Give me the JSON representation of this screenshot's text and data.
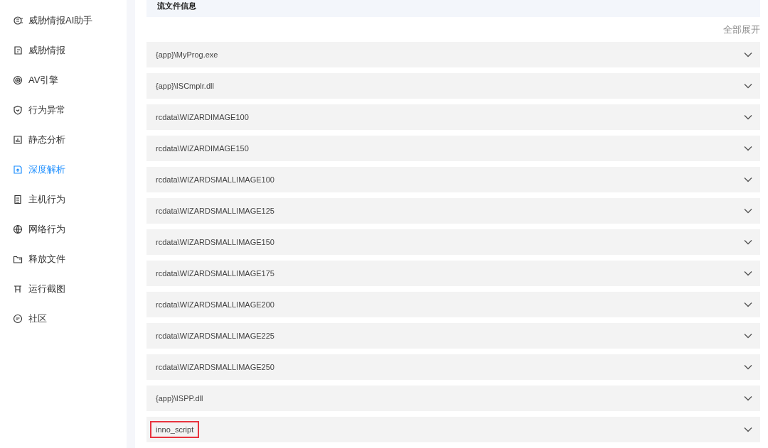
{
  "sidebar": {
    "items": [
      {
        "label": "威胁情报AI助手",
        "selected": false
      },
      {
        "label": "威胁情报",
        "selected": false
      },
      {
        "label": "AV引擎",
        "selected": false
      },
      {
        "label": "行为异常",
        "selected": false
      },
      {
        "label": "静态分析",
        "selected": false
      },
      {
        "label": "深度解析",
        "selected": true
      },
      {
        "label": "主机行为",
        "selected": false
      },
      {
        "label": "网络行为",
        "selected": false
      },
      {
        "label": "释放文件",
        "selected": false
      },
      {
        "label": "运行截图",
        "selected": false
      },
      {
        "label": "社区",
        "selected": false
      }
    ]
  },
  "section": {
    "title": "流文件信息",
    "expand_all": "全部展开"
  },
  "files": [
    {
      "name": "{app}\\MyProg.exe",
      "expanded": false,
      "highlighted": false
    },
    {
      "name": "{app}\\ISCmplr.dll",
      "expanded": false,
      "highlighted": false
    },
    {
      "name": "rcdata\\WIZARDIMAGE100",
      "expanded": false,
      "highlighted": false
    },
    {
      "name": "rcdata\\WIZARDIMAGE150",
      "expanded": false,
      "highlighted": false
    },
    {
      "name": "rcdata\\WIZARDSMALLIMAGE100",
      "expanded": false,
      "highlighted": false
    },
    {
      "name": "rcdata\\WIZARDSMALLIMAGE125",
      "expanded": false,
      "highlighted": false
    },
    {
      "name": "rcdata\\WIZARDSMALLIMAGE150",
      "expanded": false,
      "highlighted": false
    },
    {
      "name": "rcdata\\WIZARDSMALLIMAGE175",
      "expanded": false,
      "highlighted": false
    },
    {
      "name": "rcdata\\WIZARDSMALLIMAGE200",
      "expanded": false,
      "highlighted": false
    },
    {
      "name": "rcdata\\WIZARDSMALLIMAGE225",
      "expanded": false,
      "highlighted": false
    },
    {
      "name": "rcdata\\WIZARDSMALLIMAGE250",
      "expanded": false,
      "highlighted": false
    },
    {
      "name": "{app}\\ISPP.dll",
      "expanded": false,
      "highlighted": false
    },
    {
      "name": "inno_script",
      "expanded": false,
      "highlighted": true
    }
  ]
}
